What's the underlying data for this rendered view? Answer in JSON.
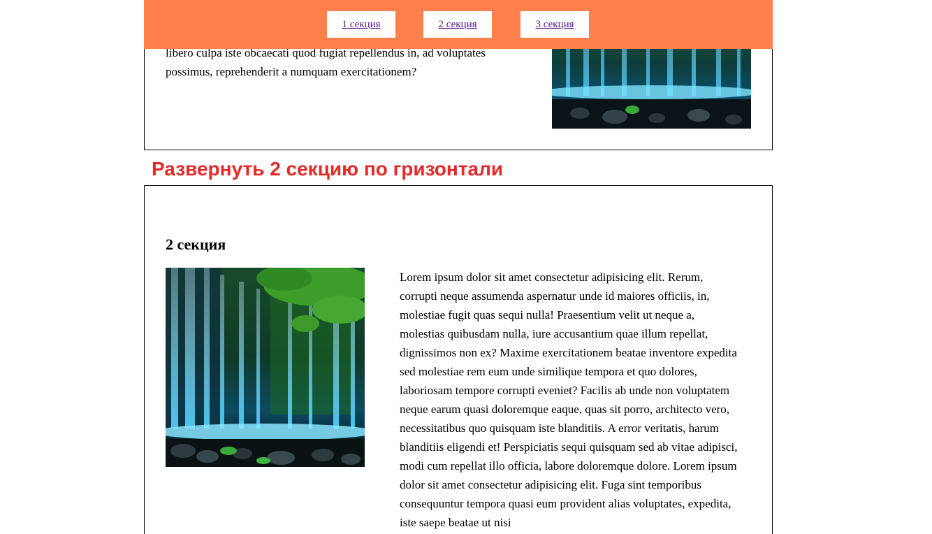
{
  "nav": {
    "links": [
      {
        "label": "1 секция"
      },
      {
        "label": "2 секция"
      },
      {
        "label": "3 секция"
      }
    ]
  },
  "section1": {
    "text": "commodi sapiente numquam voluptatibus consectetur dolores unde tempora, quidem odio voluptate. Quis ipsa sequi eligendi excepturi animi libero culpa iste obcaecati quod fugiat repellendus in, ad voluptates possimus, reprehenderit a numquam exercitationem?"
  },
  "caption": "Развернуть 2 секцию по гризонтали",
  "section2": {
    "title": "2 секция",
    "text": "Lorem ipsum dolor sit amet consectetur adipisicing elit. Rerum, corrupti neque assumenda aspernatur unde id maiores officiis, in, molestiae fugit quas sequi nulla! Praesentium velit ut neque a, molestias quibusdam nulla, iure accusantium quae illum repellat, dignissimos non ex? Maxime exercitationem beatae inventore expedita sed molestiae rem eum unde similique tempora et quo dolores, laboriosam tempore corrupti eveniet? Facilis ab unde non voluptatem neque earum quasi doloremque eaque, quas sit porro, architecto vero, necessitatibus quo quisquam iste blanditiis. A error veritatis, harum blanditiis eligendi et! Perspiciatis sequi quisquam sed ab vitae adipisci, modi cum repellat illo officia, labore doloremque dolore. Lorem ipsum dolor sit amet consectetur adipisicing elit. Fuga sint temporibus consequuntur tempora quasi eum provident alias voluptates, expedita, iste saepe beatae ut nisi"
  },
  "colors": {
    "nav_bg": "#ff7f4d",
    "caption": "#e42a2a",
    "link": "#551a8b"
  }
}
